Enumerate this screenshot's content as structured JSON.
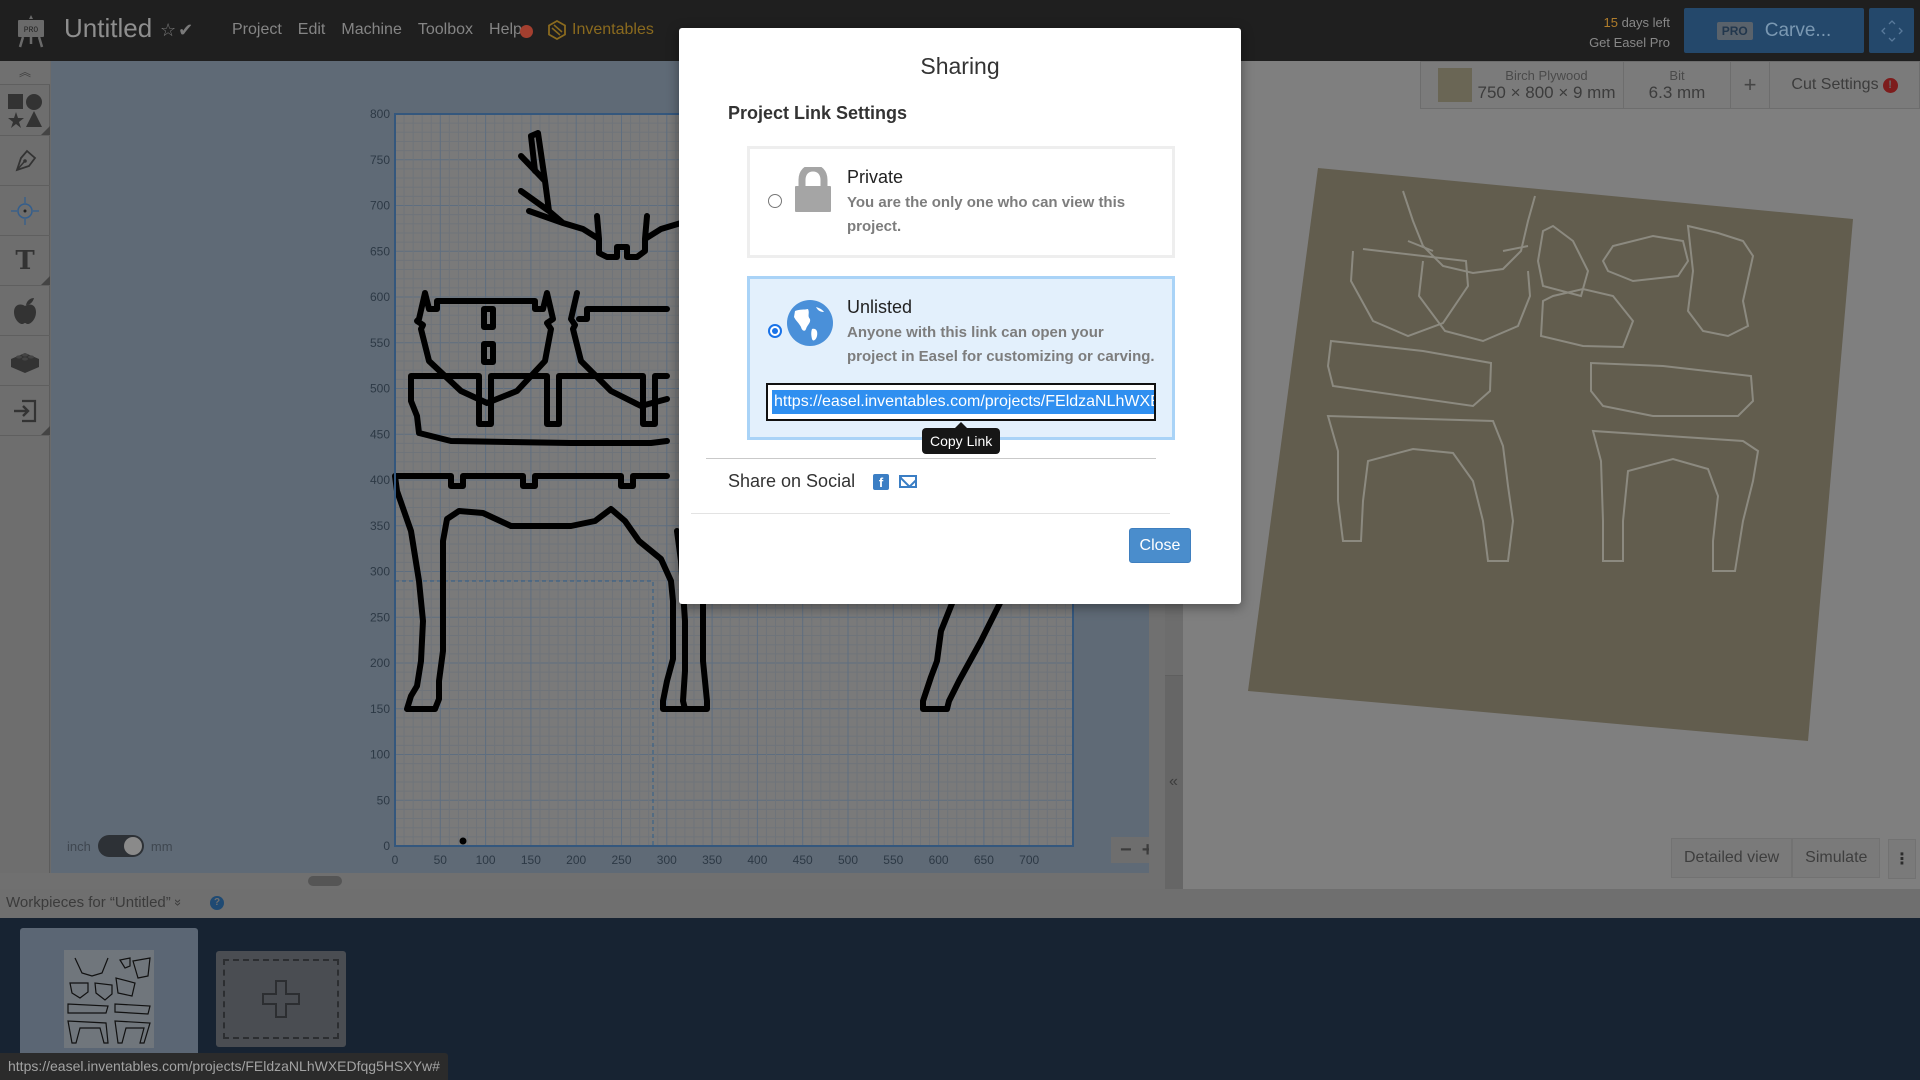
{
  "app": {
    "title": "Untitled",
    "logo_badge": "PRO",
    "menu": [
      "Project",
      "Edit",
      "Machine",
      "Toolbox",
      "Help"
    ],
    "inventables_label": "Inventables",
    "trial": {
      "days": "15",
      "days_suffix": " days left",
      "cta": "Get Easel Pro"
    },
    "carve": {
      "badge": "PRO",
      "label": "Carve..."
    }
  },
  "toolbar": {
    "tools": [
      "shapes",
      "pen",
      "target",
      "text",
      "icons",
      "apps",
      "import"
    ]
  },
  "canvas": {
    "unit_left": "inch",
    "unit_right": "mm",
    "unit_selected": "mm",
    "x_ticks": [
      "0",
      "50",
      "100",
      "150",
      "200",
      "250",
      "300",
      "350",
      "400",
      "450",
      "500",
      "550",
      "600",
      "650",
      "700"
    ],
    "y_ticks": [
      "800",
      "750",
      "700",
      "650",
      "600",
      "550",
      "500",
      "450",
      "400",
      "350",
      "300",
      "250",
      "200",
      "150",
      "100",
      "50",
      "0"
    ],
    "zoom_out": "−",
    "zoom_in": "+"
  },
  "material": {
    "name": "Birch Plywood",
    "dims": "750 × 800 × 9 mm",
    "bit_label": "Bit",
    "bit_value": "6.3 mm",
    "add": "+",
    "cut_settings": "Cut Settings",
    "cut_warning": "!",
    "swatch_color": "#6a6655"
  },
  "preview": {
    "detailed_view": "Detailed view",
    "simulate": "Simulate",
    "more": "⋮",
    "collapse": "«"
  },
  "workpieces": {
    "title": "Workpieces for “Untitled”",
    "toggle": "»",
    "help": "?"
  },
  "status_url": "https://easel.inventables.com/projects/FEldzaNLhWXEDfqg5HSXYw#",
  "modal": {
    "title": "Sharing",
    "section": "Project Link Settings",
    "options": [
      {
        "name": "Private",
        "desc": "You are the only one who can view this project.",
        "selected": false
      },
      {
        "name": "Unlisted",
        "desc": "Anyone with this link can open your project in Easel for customizing or carving.",
        "selected": true
      }
    ],
    "link": "https://easel.inventables.com/projects/FEldzaNLhWXEDfqg5HSXYw",
    "tooltip": "Copy Link",
    "social_label": "Share on Social",
    "close": "Close"
  },
  "colors": {
    "accent": "#4a8dcc",
    "selected_border": "#a9d3f7",
    "selection": "#2f8ff0"
  }
}
